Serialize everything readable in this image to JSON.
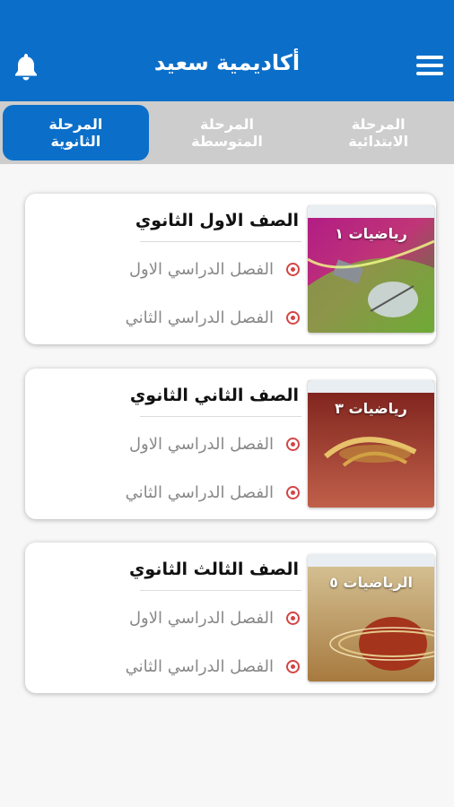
{
  "app": {
    "title": "أكاديمية سعيد"
  },
  "header": {
    "bell_icon": "bell-icon",
    "menu_icon": "hamburger-menu-icon"
  },
  "tabs": [
    {
      "label": "المرحلة الثانوية",
      "active": true
    },
    {
      "label": "المرحلة المتوسطة",
      "active": false
    },
    {
      "label": "المرحلة الابتدائية",
      "active": false
    }
  ],
  "grades": [
    {
      "title": "الصف الاول الثانوي",
      "cover_title": "رياضيات ١",
      "terms": [
        "الفصل الدراسي الاول",
        "الفصل الدراسي الثاني"
      ]
    },
    {
      "title": "الصف الثاني الثانوي",
      "cover_title": "رياضيات ٣",
      "terms": [
        "الفصل الدراسي الاول",
        "الفصل الدراسي الثاني"
      ]
    },
    {
      "title": "الصف الثالث الثانوي",
      "cover_title": "الرياضيات ٥",
      "terms": [
        "الفصل الدراسي الاول",
        "الفصل الدراسي الثاني"
      ]
    }
  ],
  "colors": {
    "primary": "#0b6fc9",
    "tab_bg": "#cdcdcd",
    "radio": "#d24646"
  }
}
